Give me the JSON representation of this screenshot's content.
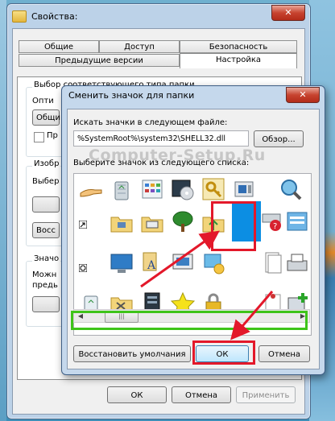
{
  "properties_window": {
    "title": "Свойства:",
    "tabs_row1": [
      "Общие",
      "Доступ",
      "Безопасность"
    ],
    "tabs_row2": [
      "Предыдущие версии",
      "Настройка"
    ],
    "active_tab": "Настройка",
    "section_folder_type": "Выбор соответствующего типа папки",
    "optimize_label": "Опти",
    "optimize_value": "Общи",
    "apply_checkbox_label": "Пр",
    "section_images": "Изобр",
    "choose_file_label": "Выбер",
    "restore_short": "Восс",
    "section_icons": "Значо",
    "icons_desc1": "Можн",
    "icons_desc2": "предь",
    "buttons": {
      "ok": "ОК",
      "cancel": "Отмена",
      "apply": "Применить"
    }
  },
  "change_icon_dialog": {
    "title": "Сменить значок для папки",
    "search_label": "Искать значки в следующем файле:",
    "path_value": "%SystemRoot%\\system32\\SHELL32.dll",
    "browse_button": "Обзор...",
    "list_label": "Выберите значок из следующего списка:",
    "restore_defaults_button": "Восстановить умолчания",
    "ok_button": "ОК",
    "cancel_button": "Отмена"
  },
  "watermark": "Computer-Setup.Ru",
  "icons": [
    "hand-share-icon",
    "recycle-bin-full-icon",
    "control-panel-icon",
    "media-dvd-icon",
    "key-icon",
    "scanner-camera-icon",
    "search-globe-icon",
    "folder-network-icon",
    "printer-folder-icon",
    "tree-icon",
    "folder-up-icon",
    "selected-blue-icon",
    "drive-help-icon",
    "control-panel-window-icon",
    "monitor-icon",
    "documents-icon",
    "computer-folder-icon",
    "network-monitor-icon",
    "page-icon",
    "printer-icon",
    "recycle-bin-empty-icon",
    "tools-folder-icon",
    "server-icon",
    "star-icon",
    "lock-icon",
    "pinned-note-icon",
    "add-program-icon"
  ],
  "colors": {
    "highlight_red": "#e3182a",
    "highlight_green": "#3ec41a",
    "selected_icon_blue": "#0c8ee3"
  }
}
